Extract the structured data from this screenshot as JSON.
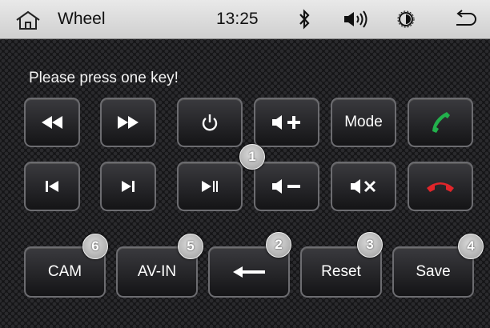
{
  "statusbar": {
    "title": "Wheel",
    "time": "13:25",
    "icons": [
      "home-icon",
      "bluetooth-icon",
      "volume-icon",
      "brightness-icon",
      "back-icon"
    ]
  },
  "prompt": "Please press one key!",
  "keys": {
    "mode_label": "Mode"
  },
  "bottom": {
    "cam": "CAM",
    "avin": "AV-IN",
    "reset": "Reset",
    "save": "Save"
  },
  "badges": {
    "b1": "1",
    "b2": "2",
    "b3": "3",
    "b4": "4",
    "b5": "5",
    "b6": "6"
  },
  "colors": {
    "call_answer": "#22b14c",
    "call_hangup": "#e0252a"
  }
}
